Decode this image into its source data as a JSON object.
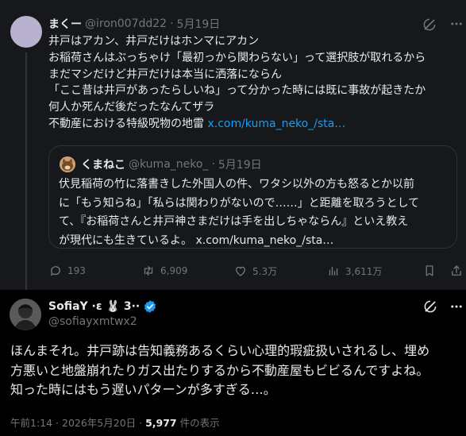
{
  "parent_tweet": {
    "display_name": "まくー",
    "handle": "@iron007dd22",
    "separator": "·",
    "date": "5月19日",
    "lines": [
      "井戸はアカン、井戸だけはホンマにアカン",
      "お稲荷さんはぶっちゃけ「最初っから関わらない」って選択肢が取れるから",
      "まだマシだけど井戸だけは本当に洒落にならん",
      "「ここ昔は井戸があったらしいね」って分かった時には既に事故が起きたか",
      "何人か死んだ後だったなんてザラ",
      "不動産における特級呪物の地雷 "
    ],
    "link": "x.com/kuma_neko_/sta…",
    "quote": {
      "display_name": "くまねこ",
      "handle": "@kuma_neko_",
      "separator": "·",
      "date": "5月19日",
      "lines": [
        "伏見稲荷の竹に落書きした外国人の件、ワタシ以外の方も怒るとか以前",
        "に「もう知らね」「私らは関わりがないので……」と距離を取ろうとして",
        "て、『お稲荷さんと井戸神さまだけは手を出しちゃならん』といえ教え",
        "が現代にも生きているよ。 "
      ],
      "link": "x.com/kuma_neko_/sta…"
    },
    "actions": {
      "replies": "193",
      "retweets": "6,909",
      "likes": "5.3万",
      "views": "3,611万"
    }
  },
  "reply_tweet": {
    "display_name": "SofiaY ·ɛ 🐰 3··",
    "handle": "@sofiayxmtwx2",
    "lines": [
      "ほんまそれ。井戸跡は告知義務あるくらい心理的瑕疵扱いされるし、埋め",
      "方悪いと地盤崩れたりガス出たりするから不動産屋もビビるんですよね。",
      "知った時にはもう遅いパターンが多すぎる…。"
    ],
    "timestamp": "午前1:14 · 2026年5月20日 · ",
    "view_count": "5,977",
    "view_label": " 件の表示"
  },
  "colors": {
    "background": "#000000",
    "parent_background": "#16181c",
    "text": "#e7e9ea",
    "muted": "#71767b",
    "link": "#1d9bf0",
    "border": "#2f3336"
  },
  "icons": [
    "grok-icon",
    "more-icon",
    "reply-icon",
    "retweet-icon",
    "like-icon",
    "views-icon",
    "bookmark-icon",
    "share-icon",
    "verified-badge-icon"
  ]
}
